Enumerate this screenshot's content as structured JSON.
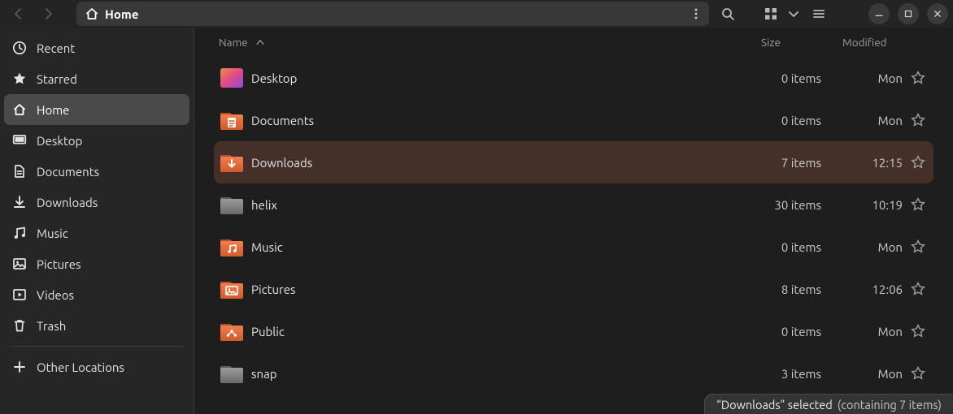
{
  "pathbar": {
    "location": "Home"
  },
  "sidebar": {
    "top": [
      {
        "label": "Recent",
        "icon": "clock"
      },
      {
        "label": "Starred",
        "icon": "star"
      },
      {
        "label": "Home",
        "icon": "home",
        "active": true
      },
      {
        "label": "Desktop",
        "icon": "desktop"
      },
      {
        "label": "Documents",
        "icon": "documents"
      },
      {
        "label": "Downloads",
        "icon": "downloads"
      },
      {
        "label": "Music",
        "icon": "music"
      },
      {
        "label": "Pictures",
        "icon": "pictures"
      },
      {
        "label": "Videos",
        "icon": "videos"
      },
      {
        "label": "Trash",
        "icon": "trash"
      }
    ],
    "other": {
      "label": "Other Locations",
      "icon": "plus"
    }
  },
  "columns": {
    "name": "Name",
    "size": "Size",
    "modified": "Modified"
  },
  "rows": [
    {
      "name": "Desktop",
      "size": "0 items",
      "modified": "Mon",
      "icon": "desktop-folder"
    },
    {
      "name": "Documents",
      "size": "0 items",
      "modified": "Mon",
      "icon": "documents-folder"
    },
    {
      "name": "Downloads",
      "size": "7 items",
      "modified": "12:15",
      "icon": "downloads-folder",
      "selected": true
    },
    {
      "name": "helix",
      "size": "30 items",
      "modified": "10:19",
      "icon": "folder"
    },
    {
      "name": "Music",
      "size": "0 items",
      "modified": "Mon",
      "icon": "music-folder"
    },
    {
      "name": "Pictures",
      "size": "8 items",
      "modified": "12:06",
      "icon": "pictures-folder"
    },
    {
      "name": "Public",
      "size": "0 items",
      "modified": "Mon",
      "icon": "public-folder"
    },
    {
      "name": "snap",
      "size": "3 items",
      "modified": "Mon",
      "icon": "folder"
    }
  ],
  "status": {
    "main": "“Downloads” selected",
    "sub": "(containing 7 items)"
  }
}
